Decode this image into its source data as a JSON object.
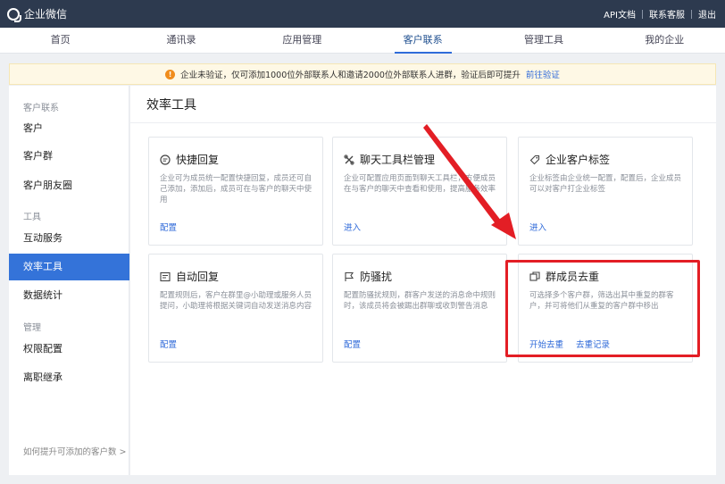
{
  "topbar": {
    "brand": "企业微信",
    "links": [
      "API文档",
      "联系客服",
      "退出"
    ]
  },
  "nav": {
    "items": [
      "首页",
      "通讯录",
      "应用管理",
      "客户联系",
      "管理工具",
      "我的企业"
    ],
    "active": 3
  },
  "notice": {
    "text": "企业未验证，仅可添加1000位外部联系人和邀请2000位外部联系人进群，验证后即可提升",
    "link": "前往验证"
  },
  "sidebar": {
    "group1": "客户联系",
    "items1": [
      "客户",
      "客户群",
      "客户朋友圈"
    ],
    "group2": "工具",
    "items2": [
      "互动服务",
      "效率工具",
      "数据统计"
    ],
    "group3": "管理",
    "items3": [
      "权限配置",
      "离职继承"
    ],
    "footer": "如何提升可添加的客户数 >"
  },
  "main": {
    "title": "效率工具",
    "cards": [
      {
        "title": "快捷回复",
        "icon": "chat-bubble-icon",
        "desc": "企业可为成员统一配置快捷回复，成员还可自己添加，添加后，成员可在与客户的聊天中使用",
        "actions": [
          "配置"
        ]
      },
      {
        "title": "聊天工具栏管理",
        "icon": "tool-icon",
        "desc": "企业可配置应用页面到聊天工具栏，方便成员在与客户的聊天中查看和使用，提高服务效率",
        "actions": [
          "进入"
        ]
      },
      {
        "title": "企业客户标签",
        "icon": "tag-icon",
        "desc": "企业标签由企业统一配置，配置后，企业成员可以对客户打企业标签",
        "actions": [
          "进入"
        ]
      },
      {
        "title": "自动回复",
        "icon": "auto-reply-icon",
        "desc": "配置规则后，客户在群里@小助理或服务人员提问，小助理将根据关键词自动发送消息内容",
        "actions": [
          "配置"
        ]
      },
      {
        "title": "防骚扰",
        "icon": "flag-icon",
        "desc": "配置防骚扰规则，群客户发送的消息命中规则时，该成员将会被踢出群聊或收到警告消息",
        "actions": [
          "配置"
        ]
      },
      {
        "title": "群成员去重",
        "icon": "dedupe-icon",
        "desc": "可选择多个客户群，筛选出其中重复的群客户，并可将他们从重复的客户群中移出",
        "actions": [
          "开始去重",
          "去重记录"
        ]
      }
    ]
  },
  "colors": {
    "topbar": "#2d3a4f",
    "accent": "#3473d9",
    "highlight": "#e31e25"
  }
}
